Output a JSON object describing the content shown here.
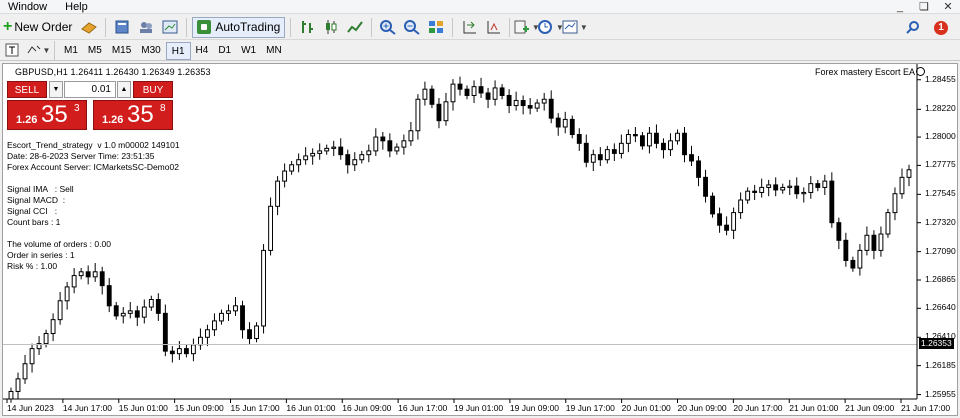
{
  "menu": {
    "items": [
      "Window",
      "Help"
    ],
    "window_controls": [
      "_",
      "❏",
      "✕"
    ]
  },
  "toolbar": {
    "new_order_label": "New Order",
    "autotrading_label": "AutoTrading",
    "notification_count": "1"
  },
  "timeframes": [
    "M1",
    "M5",
    "M15",
    "M30",
    "H1",
    "H4",
    "D1",
    "W1",
    "MN"
  ],
  "active_timeframe": "H1",
  "chart": {
    "title": "GBPUSD,H1  1.26411 1.26430 1.26349 1.26353",
    "ea_name": "Forex mastery Escort EA",
    "current_price": "1.26353"
  },
  "one_click": {
    "sell_label": "SELL",
    "buy_label": "BUY",
    "volume": "0.01",
    "sell_price_small": "1.26",
    "sell_price_big": "35",
    "sell_price_sup": "3",
    "buy_price_small": "1.26",
    "buy_price_big": "35",
    "buy_price_sup": "8"
  },
  "info_panel": {
    "line1": "Escort_Trend_strategy  v 1.0 m00002 149101",
    "line2": "Date: 28-6-2023 Server Time: 23:51:35",
    "line3": "Forex Account Server: ICMarketsSC-Demo02",
    "signal_ima": "Signal IMA   : Sell",
    "signal_macd": "Signal MACD  :",
    "signal_cci": "Signal CCI   :",
    "count_bars": "Count bars : 1",
    "volume_orders": "The volume of orders : 0.00",
    "order_series": "Order in series : 1",
    "risk": "Risk % : 1.00"
  },
  "chart_data": {
    "type": "candlestick",
    "symbol": "GBPUSD",
    "timeframe": "H1",
    "y_ticks": [
      "1.28455",
      "1.28220",
      "1.28000",
      "1.27775",
      "1.27545",
      "1.27320",
      "1.27090",
      "1.26865",
      "1.26640",
      "1.26410",
      "1.26185",
      "1.25955"
    ],
    "x_ticks": [
      "14 Jun 2023",
      "14 Jun 17:00",
      "15 Jun 01:00",
      "15 Jun 09:00",
      "15 Jun 17:00",
      "16 Jun 01:00",
      "16 Jun 09:00",
      "16 Jun 17:00",
      "19 Jun 01:00",
      "19 Jun 09:00",
      "19 Jun 17:00",
      "20 Jun 01:00",
      "20 Jun 09:00",
      "20 Jun 17:00",
      "21 Jun 01:00",
      "21 Jun 09:00",
      "21 Jun 17:00"
    ],
    "ylim": [
      1.2592,
      1.2858
    ],
    "current_price": 1.26353,
    "close_prices": [
      1.2598,
      1.2608,
      1.262,
      1.2632,
      1.2636,
      1.2644,
      1.2655,
      1.267,
      1.2681,
      1.269,
      1.2693,
      1.2689,
      1.2693,
      1.2682,
      1.2666,
      1.2658,
      1.266,
      1.2662,
      1.2657,
      1.2665,
      1.2671,
      1.266,
      1.263,
      1.2628,
      1.2632,
      1.2628,
      1.2635,
      1.2641,
      1.2647,
      1.2654,
      1.266,
      1.2662,
      1.2666,
      1.2647,
      1.264,
      1.265,
      1.271,
      1.2745,
      1.2765,
      1.2773,
      1.2778,
      1.2782,
      1.2785,
      1.2787,
      1.2789,
      1.2791,
      1.2792,
      1.2786,
      1.2778,
      1.2782,
      1.2786,
      1.2789,
      1.28,
      1.2797,
      1.2789,
      1.2792,
      1.2797,
      1.2805,
      1.283,
      1.2838,
      1.2826,
      1.2813,
      1.2828,
      1.2842,
      1.2838,
      1.2833,
      1.284,
      1.2835,
      1.283,
      1.2839,
      1.2833,
      1.2825,
      1.2829,
      1.2825,
      1.2823,
      1.2827,
      1.283,
      1.2815,
      1.2808,
      1.2814,
      1.2802,
      1.2795,
      1.278,
      1.2786,
      1.2782,
      1.279,
      1.2787,
      1.2795,
      1.2802,
      1.2801,
      1.2793,
      1.2803,
      1.2795,
      1.279,
      1.2797,
      1.2803,
      1.2786,
      1.2781,
      1.2768,
      1.2753,
      1.2739,
      1.273,
      1.2726,
      1.274,
      1.275,
      1.2757,
      1.2756,
      1.276,
      1.2762,
      1.2758,
      1.276,
      1.2761,
      1.2755,
      1.2756,
      1.2763,
      1.276,
      1.2765,
      1.2732,
      1.2718,
      1.2702,
      1.2696,
      1.271,
      1.2722,
      1.271,
      1.2723,
      1.274,
      1.2755,
      1.2768,
      1.2774
    ]
  }
}
